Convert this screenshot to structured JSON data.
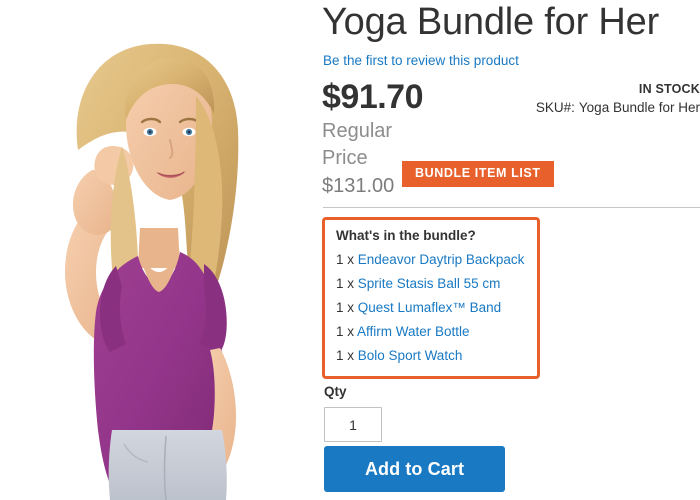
{
  "product": {
    "title": "Yoga Bundle for Her",
    "review_link": "Be the first to review this product",
    "final_price": "$91.70",
    "regular_price_label": "Regular Price",
    "regular_price_value": "$131.00",
    "stock_status": "IN STOCK",
    "sku_label": "SKU#:",
    "sku_value": "Yoga Bundle for Her",
    "image_alt": "woman-wearing-purple-v-neck-tee"
  },
  "bundle": {
    "heading": "What's in the bundle?",
    "badge": "BUNDLE  ITEM LIST",
    "items": [
      {
        "qty": "1 x",
        "name": "Endeavor Daytrip Backpack"
      },
      {
        "qty": "1 x",
        "name": "Sprite Stasis Ball 55 cm"
      },
      {
        "qty": "1 x",
        "name": "Quest Lumaflex™ Band"
      },
      {
        "qty": "1 x",
        "name": "Affirm Water Bottle"
      },
      {
        "qty": "1 x",
        "name": "Bolo Sport Watch"
      }
    ]
  },
  "purchase": {
    "qty_label": "Qty",
    "qty_value": "1",
    "add_to_cart_label": "Add to Cart"
  },
  "colors": {
    "accent_blue": "#1979c3",
    "highlight_orange": "#e8602c",
    "text_dark": "#333333",
    "text_muted": "#8d8d8d",
    "divider": "#c6c6c6"
  }
}
